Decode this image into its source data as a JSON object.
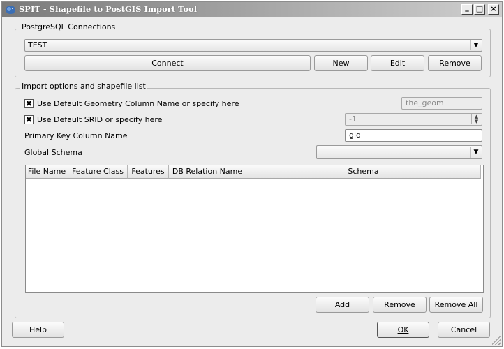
{
  "window": {
    "title": "SPIT - Shapefile to PostGIS Import Tool",
    "minimize_label": "_",
    "maximize_label": "□",
    "close_label": "×"
  },
  "connections": {
    "group_title": "PostgreSQL Connections",
    "selected": "TEST",
    "connect_label": "Connect",
    "new_label": "New",
    "edit_label": "Edit",
    "remove_label": "Remove"
  },
  "options": {
    "group_title": "Import options and shapefile list",
    "geom_check_label": "Use Default Geometry Column Name or specify here",
    "geom_check_mark": "✖",
    "geom_value": "the_geom",
    "srid_check_label": "Use Default SRID or specify here",
    "srid_check_mark": "✖",
    "srid_value": "-1",
    "pk_label": "Primary Key Column Name",
    "pk_value": "gid",
    "schema_label": "Global Schema",
    "schema_value": ""
  },
  "table": {
    "headers": [
      "File Name",
      "Feature Class",
      "Features",
      "DB Relation Name",
      "Schema"
    ]
  },
  "list_actions": {
    "add_label": "Add",
    "remove_label": "Remove",
    "remove_all_label": "Remove All"
  },
  "dialog": {
    "help_label": "Help",
    "ok_label": "OK",
    "cancel_label": "Cancel"
  },
  "colors": {
    "title_gradient_start": "#7a7a7a",
    "title_gradient_end": "#cfcfcf",
    "window_bg": "#ececec"
  }
}
